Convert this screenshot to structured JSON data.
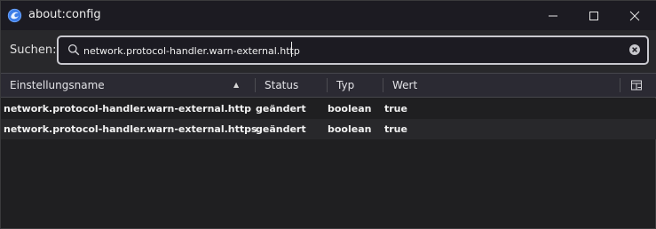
{
  "window": {
    "title": "about:config",
    "icon": "firefox-logo-icon",
    "controls": [
      "minimize-icon",
      "maximize-icon",
      "close-icon"
    ]
  },
  "search": {
    "label": "Suchen:",
    "value": "network.protocol-handler.warn-external.http",
    "icons": [
      "search-icon",
      "clear-icon"
    ]
  },
  "table": {
    "headers": {
      "name": "Einstellungsname",
      "status": "Status",
      "type": "Typ",
      "value": "Wert"
    },
    "sort": "ascending",
    "rows": [
      {
        "name": "network.protocol-handler.warn-external.http",
        "status": "geändert",
        "type": "boolean",
        "value": "true"
      },
      {
        "name": "network.protocol-handler.warn-external.https",
        "status": "geändert",
        "type": "boolean",
        "value": "true"
      }
    ]
  },
  "colors": {
    "background": "#1f1f21",
    "titlebar": "#1c1b22",
    "header": "#2b2a33",
    "text": "#f1f1f1",
    "search_border": "#c9c9cf"
  }
}
